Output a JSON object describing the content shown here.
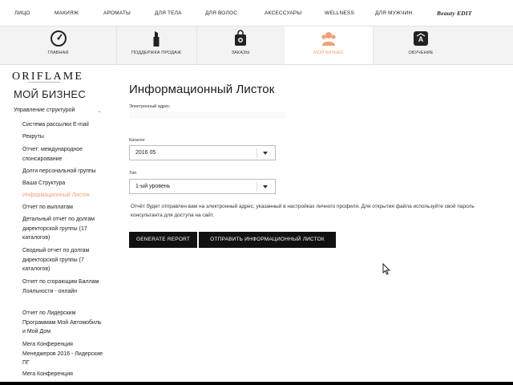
{
  "topnav": {
    "items": [
      "ЛИЦО",
      "МАКИЯЖ",
      "АРОМАТЫ",
      "ДЛЯ ТЕЛА",
      "ДЛЯ ВОЛОС",
      "АКСЕССУАРЫ",
      "WELLNESS",
      "ДЛЯ МУЖЧИН"
    ],
    "brand": "Beauty EDIT"
  },
  "iconbar": {
    "items": [
      {
        "label": "ГЛАВНАЯ",
        "icon": "speedometer-icon"
      },
      {
        "label": "ПОДДЕРЖКА ПРОДАЖ",
        "icon": "lipstick-icon"
      },
      {
        "label": "ЗАКАЗЫ",
        "icon": "shopping-bag-icon"
      },
      {
        "label": "МОЙ БИЗНЕС",
        "icon": "people-icon"
      },
      {
        "label": "ОБУЧЕНИЕ",
        "icon": "graduation-cap-icon"
      }
    ],
    "active_color": "#f0a074"
  },
  "logo": {
    "text": "ORIFLAME"
  },
  "sidebar": {
    "title": "МОЙ БИЗНЕС",
    "section": "Управление структурой",
    "items": [
      "Система рассылки E-mail",
      "Рекруты",
      "Отчет: международное спонсирование",
      "Долги персональной группы",
      "Ваша Структура",
      "Информационный Листок",
      "Отчет по выплатам",
      "Детальный отчет по долгам директорской группы (17 каталогов)",
      "Сводный отчет по долгам директорской группы (7 каталогов)",
      "Отчет по сгорающим Баллам Лояльности - онлайн",
      "Отчет по Лидерским Программам Мой Автомобиль и Мой Дом",
      "Мега Конференция Менеджеров 2016 - Лидерские ПГ",
      "Мега Конференция"
    ]
  },
  "main": {
    "title": "Информационный Листок",
    "email_label": "Электронный адрес",
    "email_value": "",
    "catalog_label": "Каталог",
    "catalog_value": "2016  05",
    "type_label": "Тип",
    "type_value": "1-ый уровень",
    "note": "Отчёт будет отправлен вам на электронный адрес, указанный в настройках личного профиля. Для открытия файла используйте свой пароль консультанта для доступа на сайт.",
    "btn_generate": "GENERATE REPORT",
    "btn_send": "ОТПРАВИТЬ ИНФОРМАЦИОННЫЙ ЛИСТОК"
  }
}
